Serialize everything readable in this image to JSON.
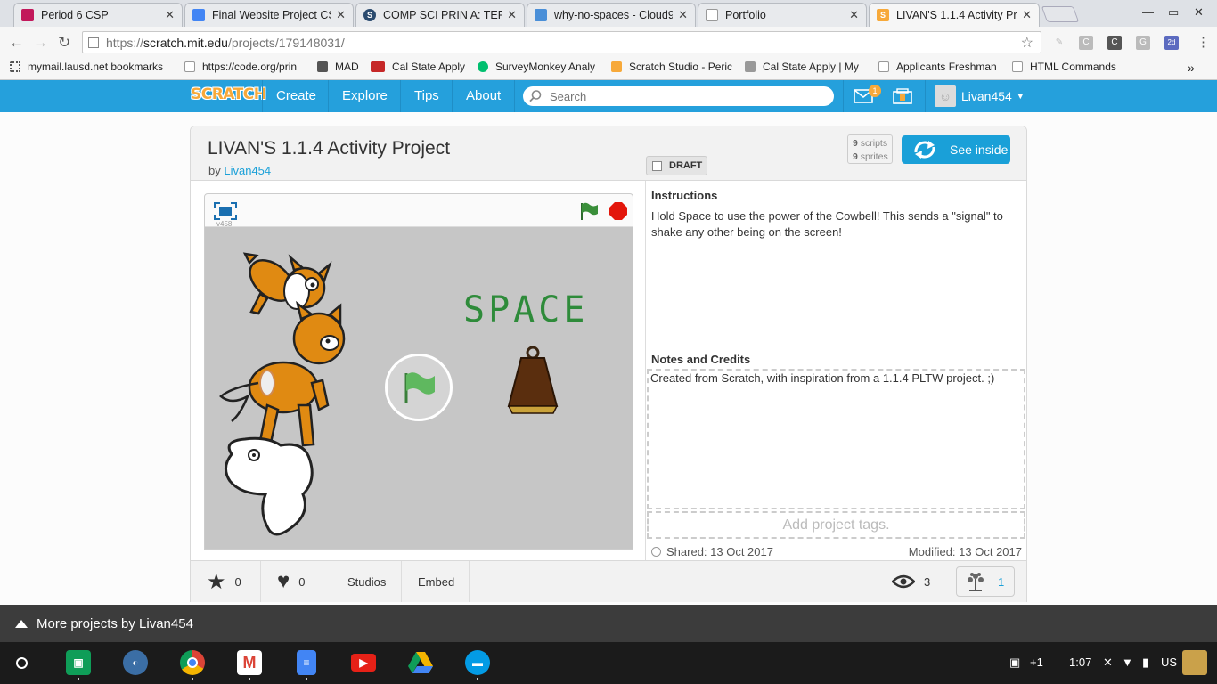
{
  "browser": {
    "tabs": [
      {
        "title": "Period 6 CSP",
        "color": "#c2185b"
      },
      {
        "title": "Final Website Project CS",
        "color": "#4285f4"
      },
      {
        "title": "COMP SCI PRIN A: TERM",
        "color": "#2b4b6f"
      },
      {
        "title": "why-no-spaces - Cloud9",
        "color": "#4a8fd8"
      },
      {
        "title": "Portfolio",
        "color": "#9e9e9e"
      },
      {
        "title": "LIVAN'S 1.1.4 Activity Pr",
        "color": "#f7a93a"
      }
    ],
    "url_scheme": "https://",
    "url_host": "scratch.mit.edu",
    "url_path": "/projects/179148031/",
    "extension_icons": [
      "C",
      "C",
      "G",
      "2d"
    ],
    "bookmarks": [
      {
        "label": "mymail.lausd.net bookmarks",
        "icon": "apps-grid-icon",
        "color": "#555"
      },
      {
        "label": "https://code.org/prin",
        "icon": "page-icon",
        "color": "#bbb"
      },
      {
        "label": "MAD",
        "icon": "folder-icon",
        "color": "#555"
      },
      {
        "label": "Cal State Apply",
        "icon": "csu-icon",
        "color": "#c62828"
      },
      {
        "label": "SurveyMonkey Analy",
        "icon": "surveymonkey-icon",
        "color": "#00bf6f"
      },
      {
        "label": "Scratch Studio - Peric",
        "icon": "scratch-icon",
        "color": "#f7a93a"
      },
      {
        "label": "Cal State Apply | My",
        "icon": "image-icon",
        "color": "#777"
      },
      {
        "label": "Applicants Freshman",
        "icon": "page-icon",
        "color": "#bbb"
      },
      {
        "label": "HTML Commands",
        "icon": "page-icon",
        "color": "#bbb"
      }
    ],
    "more_bookmarks": "»"
  },
  "scratch_nav": {
    "logo": "SCRATCH",
    "links": [
      "Create",
      "Explore",
      "Tips",
      "About"
    ],
    "search_placeholder": "Search",
    "message_count": "1",
    "username": "Livan454"
  },
  "project": {
    "title": "LIVAN'S 1.1.4 Activity Project",
    "by": "by",
    "author": "Livan454",
    "draft_label": "DRAFT",
    "scripts_count": "9",
    "scripts_label": "scripts",
    "sprites_count": "9",
    "sprites_label": "sprites",
    "see_inside": "See inside",
    "version": "v458",
    "stage_text": "SPACE",
    "instructions_title": "Instructions",
    "instructions": "Hold Space to use the power of the Cowbell! This sends a \"signal\" to shake any other being on the screen!",
    "notes_title": "Notes and Credits",
    "notes": "Created from Scratch, with inspiration from a 1.1.4 PLTW project. ;)",
    "tags_placeholder": "Add project tags.",
    "shared": "Shared: 13 Oct 2017",
    "modified": "Modified: 13 Oct 2017"
  },
  "footer": {
    "favorites": "0",
    "loves": "0",
    "studios": "Studios",
    "embed": "Embed",
    "views": "3",
    "remixes": "1"
  },
  "more_projects": "More projects by Livan454",
  "shelf": {
    "apps": [
      {
        "name": "classroom",
        "color": "#0f9d58"
      },
      {
        "name": "unknown-app",
        "color": "#3b6ea5"
      },
      {
        "name": "chrome",
        "color": "#db4437"
      },
      {
        "name": "gmail",
        "color": "#ffffff"
      },
      {
        "name": "docs",
        "color": "#4285f4"
      },
      {
        "name": "youtube",
        "color": "#e62117"
      },
      {
        "name": "drive",
        "color": "#1fa463"
      },
      {
        "name": "files",
        "color": "#039be5"
      }
    ],
    "notification_count": "+1",
    "time": "1:07",
    "locale": "US"
  }
}
